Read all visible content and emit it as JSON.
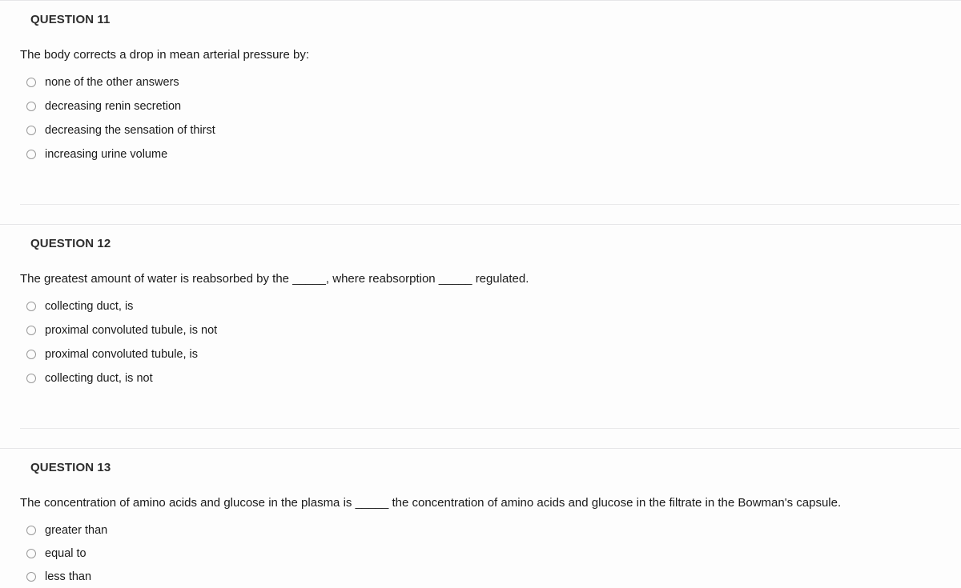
{
  "page": {
    "background_color": "#fdfdfd",
    "text_color": "#1a1a1a",
    "heading_color": "#2d2d2d",
    "rule_color": "#e6e6e8",
    "radio_border_color": "#9a9a9a"
  },
  "questions": [
    {
      "header": "QUESTION 11",
      "text": "The body corrects a drop in mean arterial pressure by:",
      "options": [
        {
          "label": "none of the other answers",
          "selected": false
        },
        {
          "label": "decreasing renin secretion",
          "selected": false
        },
        {
          "label": "decreasing the sensation of thirst",
          "selected": false
        },
        {
          "label": "increasing urine volume",
          "selected": false
        }
      ]
    },
    {
      "header": "QUESTION 12",
      "text": "The greatest amount of water is reabsorbed by the _____, where reabsorption _____ regulated.",
      "options": [
        {
          "label": "collecting duct, is",
          "selected": false
        },
        {
          "label": "proximal convoluted tubule, is not",
          "selected": false
        },
        {
          "label": "proximal convoluted tubule, is",
          "selected": false
        },
        {
          "label": "collecting duct, is not",
          "selected": false
        }
      ]
    },
    {
      "header": "QUESTION 13",
      "text": "The concentration of amino acids and glucose in the plasma is _____ the concentration of amino acids and glucose in the filtrate in the Bowman's capsule.",
      "options": [
        {
          "label": "greater than",
          "selected": false
        },
        {
          "label": "equal to",
          "selected": false
        },
        {
          "label": "less than",
          "selected": false
        }
      ]
    }
  ]
}
